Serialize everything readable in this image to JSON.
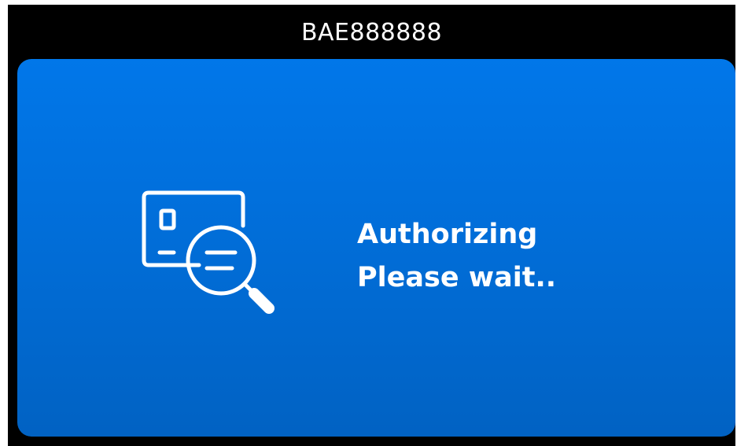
{
  "header": {
    "title": "BAE888888"
  },
  "status": {
    "icon": "card-search-icon",
    "line1": "Authorizing",
    "line2": "Please wait.."
  },
  "colors": {
    "background": "#000000",
    "panel_top": "#0177e9",
    "panel_bottom": "#0162c3",
    "text": "#ffffff"
  }
}
